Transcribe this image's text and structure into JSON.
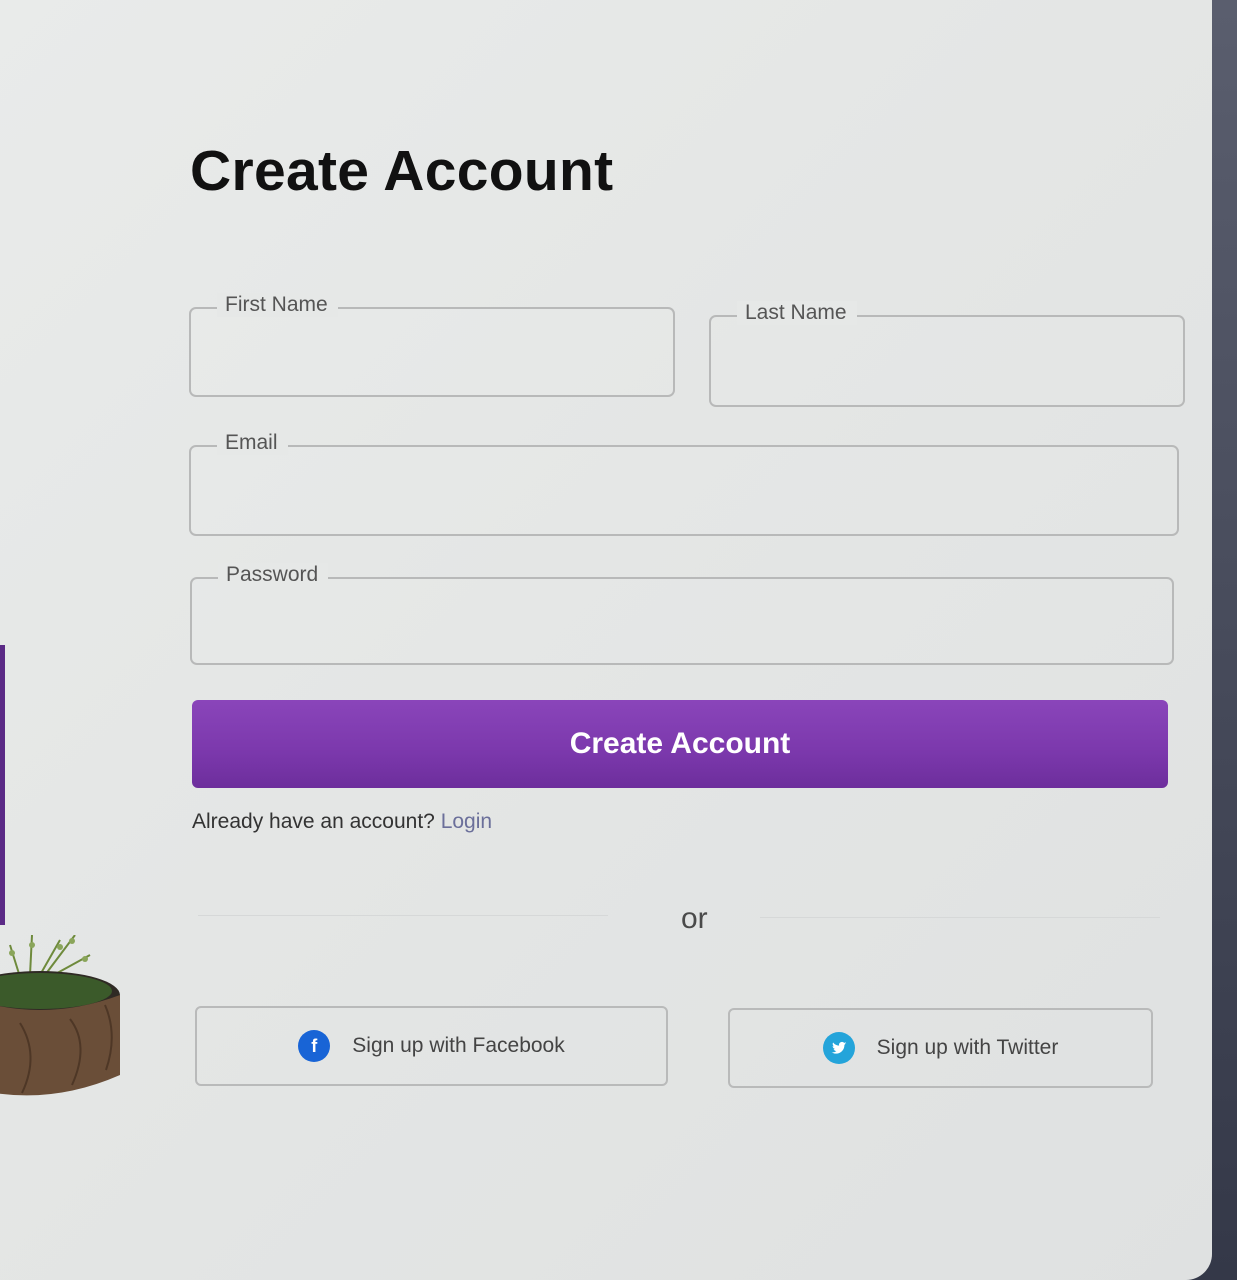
{
  "form": {
    "title": "Create Account",
    "fields": {
      "first_name": {
        "label": "First Name",
        "value": ""
      },
      "last_name": {
        "label": "Last Name",
        "value": ""
      },
      "email": {
        "label": "Email",
        "value": ""
      },
      "password": {
        "label": "Password",
        "value": ""
      }
    },
    "submit_label": "Create Account",
    "login_prompt": "Already have an account?",
    "login_link": "Login",
    "divider_text": "or"
  },
  "social": {
    "facebook": {
      "label": "Sign up with Facebook",
      "icon": "facebook-icon",
      "color": "#1864d6"
    },
    "twitter": {
      "label": "Sign up with Twitter",
      "icon": "twitter-icon",
      "color": "#24a4da"
    }
  },
  "colors": {
    "accent": "#7b38ac",
    "card_background": "#e6e8e7"
  }
}
